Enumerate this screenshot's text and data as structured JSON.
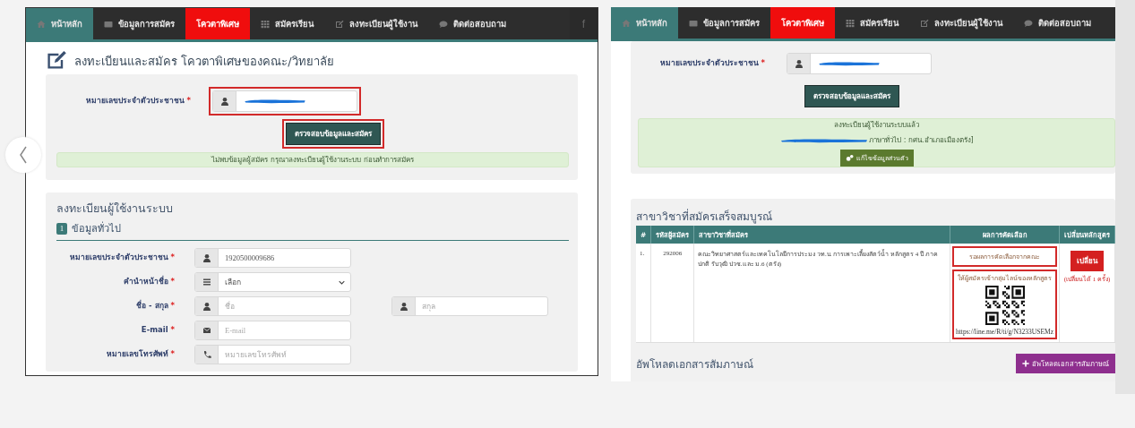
{
  "slides": [
    {
      "nav": {
        "items": [
          {
            "label": "หน้าหลัก",
            "kind": "home",
            "selected": false
          },
          {
            "label": "ข้อมูลการสมัคร",
            "kind": "link",
            "selected": false
          },
          {
            "label": "โควตาพิเศษ",
            "kind": "link",
            "selected": true
          },
          {
            "label": "สมัครเรียน",
            "kind": "link",
            "selected": false
          },
          {
            "label": "ลงทะเบียนผู้ใช้งาน",
            "kind": "link",
            "selected": false
          },
          {
            "label": "ติดต่อสอบถาม",
            "kind": "link",
            "selected": false
          }
        ],
        "social": "f"
      },
      "page_title": "ลงทะเบียนและสมัคร โควตาพิเศษของคณะ/วิทยาลัย",
      "lookup": {
        "label": "หมายเลขประจำตัวประชาชน",
        "mark": "*",
        "redacted": true,
        "highlighted": true
      },
      "check_button": {
        "label": "ตรวจสอบข้อมูลและสมัคร",
        "highlighted": true
      },
      "alert": {
        "lines": [
          {
            "text": "ไม่พบข้อมูลผู้สมัคร กรุณาลงทะเบียนผู้ใช้งานระบบ ก่อนทำการสมัคร",
            "redacted": false
          }
        ]
      },
      "register": {
        "title": "ลงทะเบียนผู้ใช้งานระบบ",
        "step": {
          "number": "1",
          "label": "ข้อมูลทั่วไป"
        },
        "fields": [
          {
            "kind": "text",
            "label": "หมายเลขประจำตัวประชาชน",
            "mark": "*",
            "value": "1920500009686"
          },
          {
            "kind": "select",
            "label": "คำนำหน้าชื่อ",
            "mark": "*",
            "value": "เลือก"
          },
          {
            "kind": "pair",
            "label": "ชื่อ - สกุล",
            "mark": "*",
            "placeholders": [
              "ชื่อ",
              "สกุล"
            ]
          },
          {
            "kind": "text",
            "label": "E-mail",
            "mark": "*",
            "placeholder": "E-mail"
          },
          {
            "kind": "text",
            "label": "หมายเลขโทรศัพท์",
            "mark": "*",
            "placeholder": "หมายเลขโทรศัพท์"
          }
        ]
      }
    },
    {
      "nav": {
        "items": [
          {
            "label": "หน้าหลัก",
            "kind": "home",
            "selected": false
          },
          {
            "label": "ข้อมูลการสมัคร",
            "kind": "link",
            "selected": false
          },
          {
            "label": "โควตาพิเศษ",
            "kind": "link",
            "selected": true
          },
          {
            "label": "สมัครเรียน",
            "kind": "link",
            "selected": false
          },
          {
            "label": "ลงทะเบียนผู้ใช้งาน",
            "kind": "link",
            "selected": false
          },
          {
            "label": "ติดต่อสอบถาม",
            "kind": "link",
            "selected": false
          }
        ]
      },
      "lookup": {
        "label": "หมายเลขประจำตัวประชาชน",
        "mark": "*",
        "redacted": true,
        "highlighted": false
      },
      "check_button": {
        "label": "ตรวจสอบข้อมูลและสมัคร",
        "highlighted": false
      },
      "alert": {
        "lines": [
          {
            "text": "ลงทะเบียนผู้ใช้งานระบบแล้ว",
            "redacted": false
          },
          {
            "text": "ภาษาทั่วไป : กศน.อำเภอเมืองตรัง]",
            "redacted": true
          }
        ],
        "button": "แก้ไขข้อมูลส่วนตัว"
      },
      "applications": {
        "title": "สาขาวิชาที่สมัครเสร็จสมบูรณ์",
        "columns": [
          "#",
          "รหัสผู้สมัคร",
          "สาขาวิชาที่สมัคร",
          "ผลการคัดเลือก",
          "เปลี่ยนหลักสูตร"
        ],
        "rows": [
          {
            "number": "1.",
            "applicant_id": "292006",
            "program": "คณะวิทยาศาสตร์และเทคโนโลยีการประมง วท.บ. การเพาะเลี้ยงสัตว์น้ำ หลักสูตร 4 ปี ภาคปกติ รับวุฒิ ปวช.และ ม.6 (ตรัง)",
            "result": "รอผลการคัดเลือกจากคณะ",
            "result_highlighted": true,
            "group_note": "ให้ผู้สมัครเข้ากลุ่มไลน์ของหลักสูตร",
            "group_link": "https://line.me/R/ti/g/N3233USEMz",
            "group_highlighted": true,
            "change_button": "เปลี่ยน",
            "change_note": "(เปลี่ยนได้ 1 ครั้ง)"
          }
        ]
      },
      "upload": {
        "title": "อัพโหลดเอกสารสัมภาษณ์",
        "button": "อัพโหลดเอกสารสัมภาษณ์"
      }
    }
  ]
}
